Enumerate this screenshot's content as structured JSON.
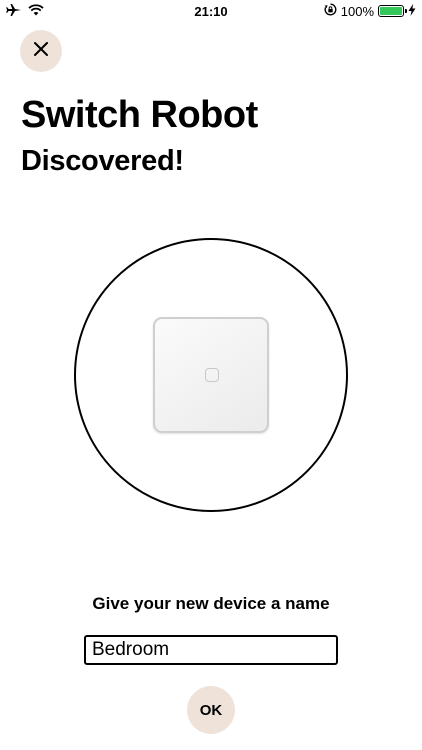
{
  "status_bar": {
    "time": "21:10",
    "battery_percent": "100%",
    "battery_level": 1.0,
    "icons": [
      "airplane-icon",
      "wifi-icon",
      "rotation-lock-icon",
      "battery-icon",
      "charging-bolt-icon"
    ]
  },
  "header": {
    "close_icon": "close-icon",
    "title": "Switch Robot",
    "subtitle": "Discovered!"
  },
  "device": {
    "image": "switch-robot-device-image"
  },
  "form": {
    "label": "Give your new device a name",
    "name_value": "Bedroom",
    "ok_label": "OK"
  },
  "colors": {
    "accent_beige": "#efe3d9",
    "battery_green": "#34c759",
    "text": "#000000",
    "background": "#ffffff"
  }
}
